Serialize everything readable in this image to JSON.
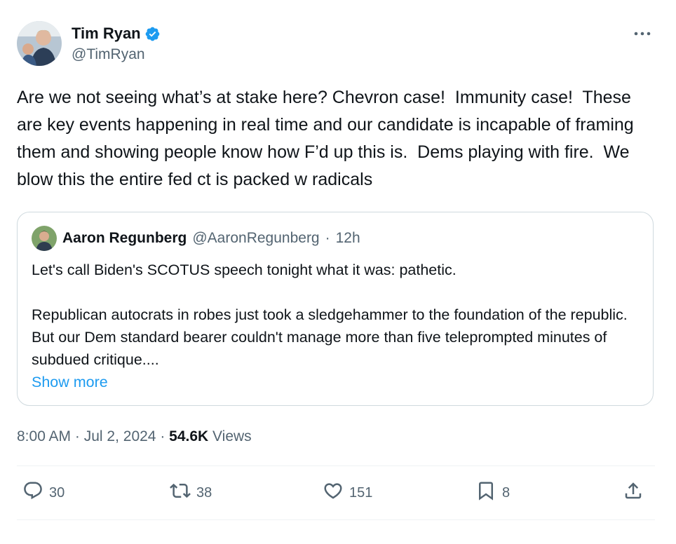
{
  "author": {
    "display_name": "Tim Ryan",
    "handle": "@TimRyan"
  },
  "tweet": {
    "text": "Are we not seeing what’s at stake here? Chevron case!  Immunity case!  These are key events happening in real time and our candidate is incapable of framing them and showing people know how F’d up this is.  Dems playing with fire.  We blow this the entire fed ct is packed w radicals",
    "time": "8:00 AM",
    "date": "Jul 2, 2024",
    "views_count": "54.6K",
    "views_label": "Views"
  },
  "quote": {
    "display_name": "Aaron Regunberg",
    "handle": "@AaronRegunberg",
    "age": "12h",
    "text": "Let's call Biden's SCOTUS speech tonight what it was: pathetic.\n\nRepublican autocrats in robes just took a sledgehammer to the foundation of the republic. But our Dem standard bearer couldn't manage more than five teleprompted minutes of subdued critique....",
    "show_more": "Show more"
  },
  "actions": {
    "replies": "30",
    "reposts": "38",
    "likes": "151",
    "bookmarks": "8"
  },
  "colors": {
    "accent": "#1d9bf0",
    "secondary_text": "#536471",
    "border": "#cfd9de"
  },
  "icons": [
    "verified-badge-icon",
    "more-options-icon",
    "reply-icon",
    "repost-icon",
    "like-icon",
    "bookmark-icon",
    "share-icon"
  ]
}
